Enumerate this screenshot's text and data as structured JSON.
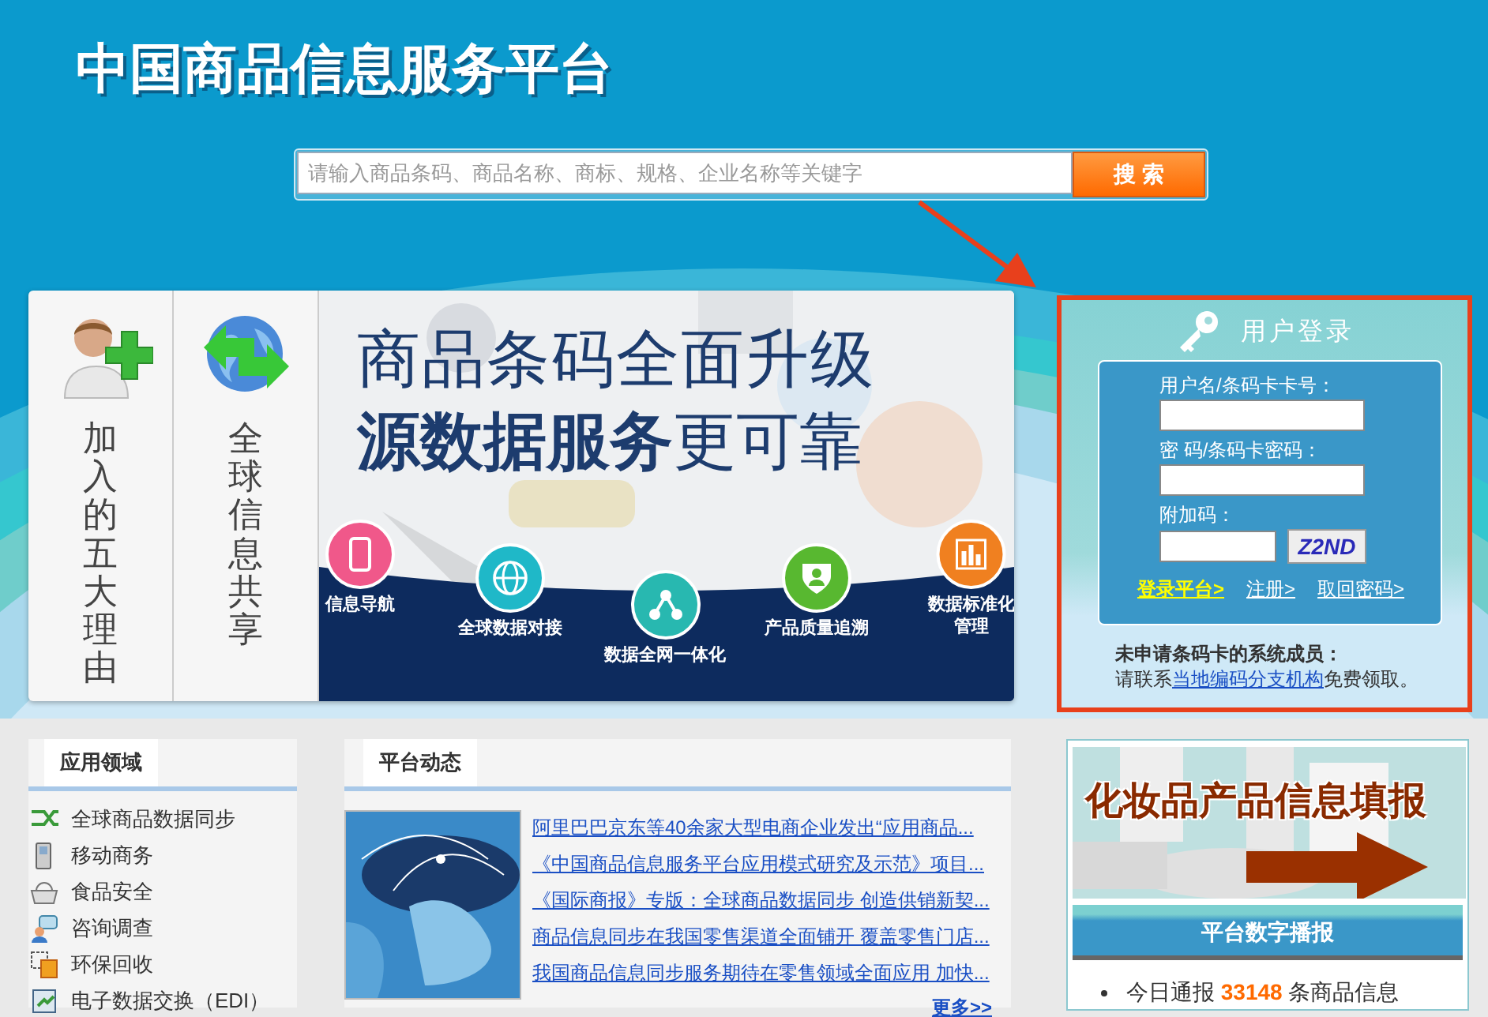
{
  "header": {
    "title": "中国商品信息服务平台",
    "search": {
      "placeholder": "请输入商品条码、商品名称、商标、规格、企业名称等关键字",
      "button": "搜 索"
    }
  },
  "banner": {
    "side_items": [
      {
        "label": "加入的五大理由"
      },
      {
        "label": "全球信息共享"
      }
    ],
    "headline": "商品条码全面升级",
    "subline": "**源数据服务**更可靠",
    "features": [
      {
        "label": "信息导航",
        "color": "#f0588a"
      },
      {
        "label": "全球数据对接",
        "color": "#1fb8c8"
      },
      {
        "label": "数据全网一体化",
        "color": "#28b8b0"
      },
      {
        "label": "产品质量追溯",
        "color": "#58b830"
      },
      {
        "label": "数据标准化管理",
        "color": "#f08020"
      }
    ]
  },
  "login": {
    "title": "用户登录",
    "fields": [
      {
        "label": "用户名/条码卡卡号："
      },
      {
        "label": "密 码/条码卡密码："
      }
    ],
    "captcha": {
      "label": "附加码：",
      "code": "Z2ND"
    },
    "links": [
      {
        "label": "登录平台>",
        "primary": true
      },
      {
        "label": "注册>",
        "primary": false
      },
      {
        "label": "取回密码>",
        "primary": false
      }
    ],
    "note": "未申请条码卡的系统成员：",
    "contact": {
      "before": "请联系",
      "link": "当地编码分支机构",
      "after": "免费领取。"
    }
  },
  "areas": {
    "title": "应用领域",
    "items": [
      {
        "label": "全球商品数据同步"
      },
      {
        "label": "移动商务"
      },
      {
        "label": "食品安全"
      },
      {
        "label": "咨询调查"
      },
      {
        "label": "环保回收"
      },
      {
        "label": "电子数据交换（EDI）"
      }
    ]
  },
  "news": {
    "title": "平台动态",
    "items": [
      "阿里巴巴京东等40余家大型电商企业发出“应用商品...",
      "《中国商品信息服务平台应用模式研究及示范》项目...",
      "《国际商报》专版：全球商品数据同步 创造供销新契...",
      "商品信息同步在我国零售渠道全面铺开 覆盖零售门店...",
      "我国商品信息同步服务期待在零售领域全面应用 加快..."
    ],
    "more": "更多>>"
  },
  "side": {
    "promo": "化妆品产品信息填报",
    "broadcast": {
      "title": "平台数字播报",
      "stats": [
        "今日通报 **33148** 条商品信息"
      ]
    }
  }
}
